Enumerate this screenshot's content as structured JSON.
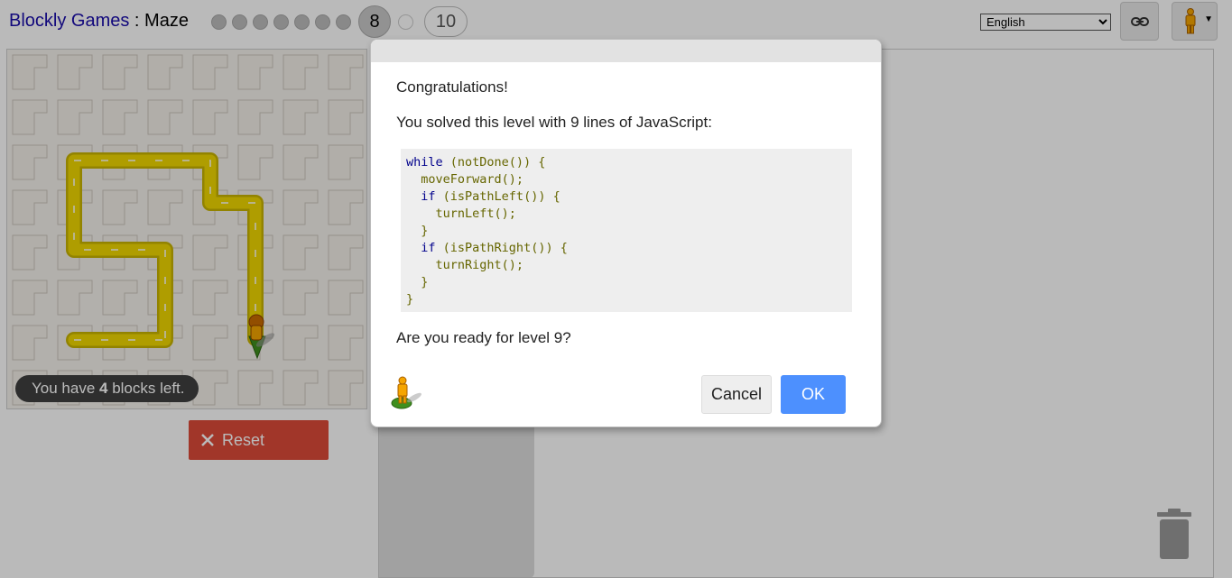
{
  "header": {
    "app_link": "Blockly Games",
    "separator": " : ",
    "game_name": "Maze",
    "current_level": "8",
    "last_level": "10",
    "language_selected": "English"
  },
  "maze": {
    "capacity_prefix": "You have ",
    "capacity_count": "4",
    "capacity_suffix": " blocks left.",
    "reset_label": "Reset"
  },
  "dialog": {
    "congrats": "Congratulations!",
    "solved": "You solved this level with 9 lines of JavaScript:",
    "code_lines": [
      "while (notDone()) {",
      "  moveForward();",
      "  if (isPathLeft()) {",
      "    turnLeft();",
      "  }",
      "  if (isPathRight()) {",
      "    turnRight();",
      "  }",
      "}"
    ],
    "ready": "Are you ready for level 9?",
    "cancel_label": "Cancel",
    "ok_label": "OK"
  },
  "icons": {
    "link": "link-icon",
    "pegman": "pegman-icon",
    "reset": "close-icon",
    "trash": "trash-icon"
  },
  "colors": {
    "path": "#f0d800",
    "reset": "#dd4b39",
    "ok": "#4d90fe",
    "link": "#1a0dab"
  }
}
